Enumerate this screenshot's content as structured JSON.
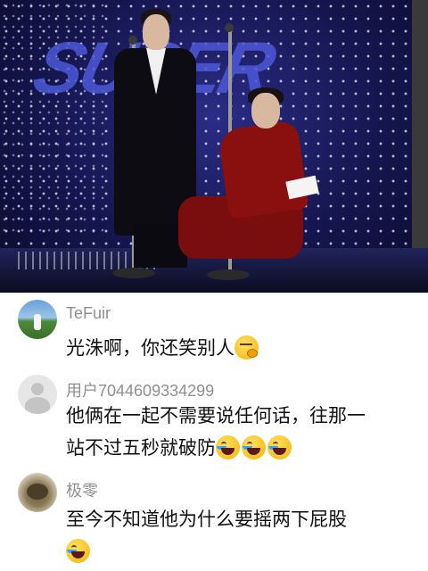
{
  "comments": [
    {
      "username": "TeFuir",
      "avatar": "landscape-photo-avatar",
      "text": "光洙啊，你还笑别人",
      "emojis": [
        "thinking-hand-on-chin-emoji"
      ]
    },
    {
      "username": "用户7044609334299",
      "avatar": "default-user-avatar",
      "text_line1": "他俩在一起不需要说任何话，往那一",
      "text_line2": "站不过五秒就破防",
      "emojis": [
        "laughing-crying-emoji",
        "laughing-crying-emoji",
        "laughing-crying-emoji"
      ]
    },
    {
      "username": "极零",
      "avatar": "cat-photo-avatar",
      "text": "至今不知道他为什么要摇两下屁股",
      "emojis": [
        "laughing-crying-emoji"
      ]
    }
  ],
  "colors": {
    "username": "#8f8f8f",
    "text": "#111111",
    "stage_background": "#151650",
    "suit_red": "#8a1010"
  }
}
